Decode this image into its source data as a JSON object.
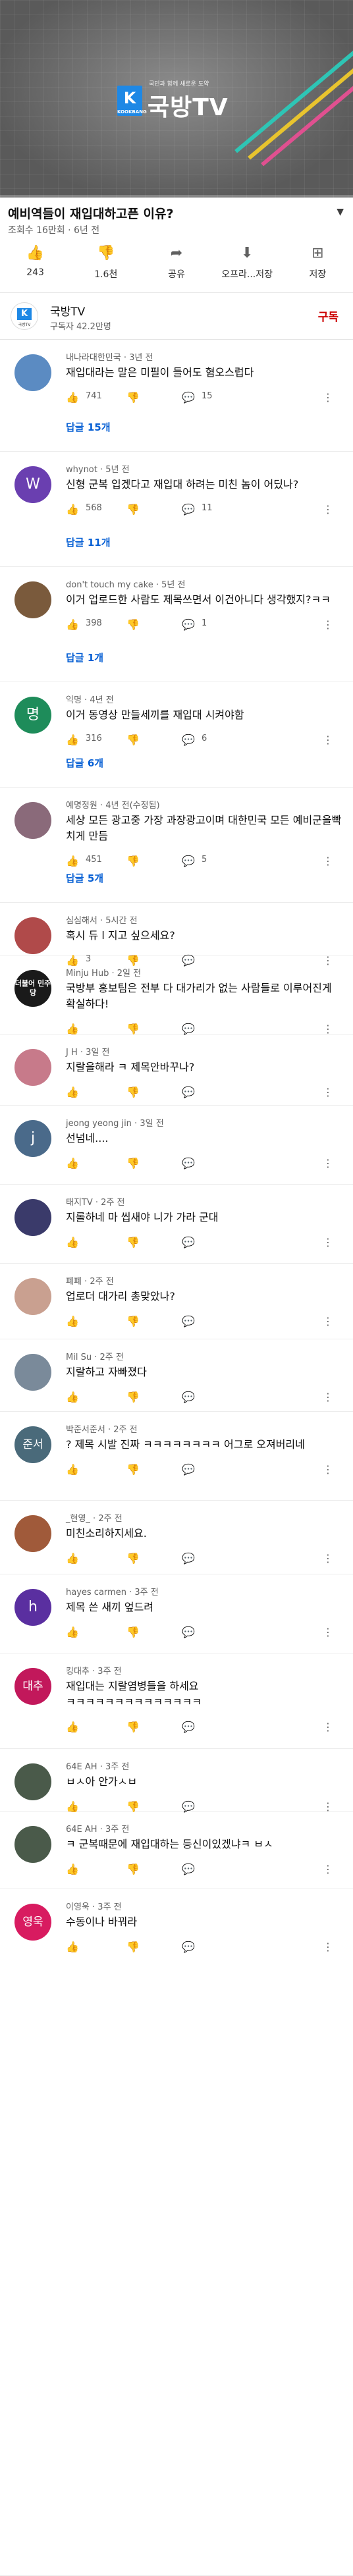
{
  "player": {
    "logo_k": "K",
    "logo_k_sub": "KOOKBANG",
    "logo_slogan": "국민과 함께 새로운 도약",
    "logo_name": "국방TV",
    "progress": 0.0
  },
  "video": {
    "title": "예비역들이 재입대하고픈 이유?",
    "meta": "조회수 16만회 · 6년 전",
    "expand_icon": "chevron-down-icon"
  },
  "actions": [
    {
      "name": "like",
      "icon": "thumb-up-icon",
      "label": "243"
    },
    {
      "name": "dislike",
      "icon": "thumb-down-icon",
      "label": "1.6천"
    },
    {
      "name": "share",
      "icon": "share-icon",
      "label": "공유"
    },
    {
      "name": "download",
      "icon": "download-icon",
      "label": "오프라...저장"
    },
    {
      "name": "save",
      "icon": "playlist-add-icon",
      "label": "저장"
    }
  ],
  "channel": {
    "avatar_k": "K",
    "avatar_text": "국방TV",
    "name": "국방TV",
    "subscribers": "구독자 42.2만명",
    "subscribe_label": "구독"
  },
  "colors": {
    "accent_red": "#cc0000",
    "link_blue": "#065fd4"
  },
  "comments": [
    {
      "author": "내나라대한민국",
      "time": "3년 전",
      "text": "재입대라는 말은 미필이 들어도 혐오스럽다",
      "likes": "741",
      "replies_count": "15",
      "replies_link": "답글 15개",
      "avatar_text": "",
      "avatar_color": "#5b8bc2"
    },
    {
      "author": "whynot",
      "time": "5년 전",
      "text": "신형 군복 입겠다고 재입대 하려는 미친 놈이 어딨나?",
      "likes": "568",
      "replies_count": "11",
      "replies_link": "답글 11개",
      "avatar_text": "W",
      "avatar_color": "#6a3fb0"
    },
    {
      "author": "don't touch my cake",
      "time": "5년 전",
      "text": "이거 업로드한 사람도 제목쓰면서 이건아니다 생각했지?ㅋㅋ",
      "likes": "398",
      "replies_count": "1",
      "replies_link": "답글 1개",
      "avatar_text": "",
      "avatar_color": "#7a5a3c"
    },
    {
      "author": "익명",
      "time": "4년 전",
      "text": "이거 동영상 만들세끼를 재입대 시켜야함",
      "likes": "316",
      "replies_count": "6",
      "replies_link": "답글 6개",
      "avatar_text": "명",
      "avatar_color": "#1e8c5a"
    },
    {
      "author": "예명정원",
      "time": "4년 전(수정됨)",
      "text": "세상 모든 광고중 가장 과장광고이며 대한민국 모든 예비군을빡치게 만듬",
      "likes": "451",
      "replies_count": "5",
      "replies_link": "답글 5개",
      "avatar_text": "",
      "avatar_color": "#8a6a7a"
    },
    {
      "author": "심심해서",
      "time": "5시간 전",
      "text": "혹시 듀 l 지고 싶으세요?",
      "likes": "3",
      "replies_count": "",
      "replies_link": "",
      "avatar_text": "",
      "avatar_color": "#b04a4a"
    },
    {
      "author": "Minju Hub",
      "time": "2일 전",
      "text": "국방부 홍보팀은 전부 다 대가리가 없는 사람들로 이루어진게 확실하다!",
      "likes": "",
      "replies_count": "",
      "replies_link": "",
      "avatar_text": "더불어 민주당",
      "avatar_color": "#1a1a1a"
    },
    {
      "author": "J H",
      "time": "3일 전",
      "text": "지랄을해라 ㅋ 제목안바꾸나?",
      "likes": "",
      "replies_count": "",
      "replies_link": "",
      "avatar_text": "",
      "avatar_color": "#c77a8a"
    },
    {
      "author": "jeong yeong jin",
      "time": "3일 전",
      "text": "선넘네....",
      "likes": "",
      "replies_count": "",
      "replies_link": "",
      "avatar_text": "j",
      "avatar_color": "#4a6a8a"
    },
    {
      "author": "태지TV",
      "time": "2주 전",
      "text": "지롤하네 마 씹새야 니가 가라 군대",
      "likes": "",
      "replies_count": "",
      "replies_link": "",
      "avatar_text": "",
      "avatar_color": "#3a3a6a"
    },
    {
      "author": "폐폐",
      "time": "2주 전",
      "text": "업로더 대가리 총맞았나?",
      "likes": "",
      "replies_count": "",
      "replies_link": "",
      "avatar_text": "",
      "avatar_color": "#c9a090"
    },
    {
      "author": "Mil Su",
      "time": "2주 전",
      "text": "지랄하고 자빠졌다",
      "likes": "",
      "replies_count": "",
      "replies_link": "",
      "avatar_text": "",
      "avatar_color": "#7a8a9a"
    },
    {
      "author": "박준서준서",
      "time": "2주 전",
      "text": "? 제목 시발 진짜 ㅋㅋㅋㅋㅋㅋㅋㅋ 어그로 오져버리네",
      "likes": "",
      "replies_count": "",
      "replies_link": "",
      "avatar_text": "준서",
      "avatar_color": "#4a6a7a"
    },
    {
      "author": "_현영_",
      "time": "2주 전",
      "text": "미친소리하지세요.",
      "likes": "",
      "replies_count": "",
      "replies_link": "",
      "avatar_text": "",
      "avatar_color": "#a05a3a"
    },
    {
      "author": "hayes carmen",
      "time": "3주 전",
      "text": "제목 쓴 새끼 엎드려",
      "likes": "",
      "replies_count": "",
      "replies_link": "",
      "avatar_text": "h",
      "avatar_color": "#5a2fa0"
    },
    {
      "author": "킹대추",
      "time": "3주 전",
      "text": "재입대는 지랄염병들을 하세요\nㅋㅋㅋㅋㅋㅋㅋㅋㅋㅋㅋㅋㅋㅋ",
      "likes": "",
      "replies_count": "",
      "replies_link": "",
      "avatar_text": "대추",
      "avatar_color": "#c2185b"
    },
    {
      "author": "64E AH",
      "time": "3주 전",
      "text": "ㅂㅅ아 안가ㅅㅂ",
      "likes": "",
      "replies_count": "",
      "replies_link": "",
      "avatar_text": "",
      "avatar_color": "#4a5a4a"
    },
    {
      "author": "64E AH",
      "time": "3주 전",
      "text": "ㅋ 군복때문에 재입대하는 등신이있겠냐ㅋ ㅂㅅ",
      "likes": "",
      "replies_count": "",
      "replies_link": "",
      "avatar_text": "",
      "avatar_color": "#4a5a4a"
    },
    {
      "author": "이영욱",
      "time": "3주 전",
      "text": "수동이나 바꿔라",
      "likes": "",
      "replies_count": "",
      "replies_link": "",
      "avatar_text": "영욱",
      "avatar_color": "#d81b60"
    }
  ]
}
